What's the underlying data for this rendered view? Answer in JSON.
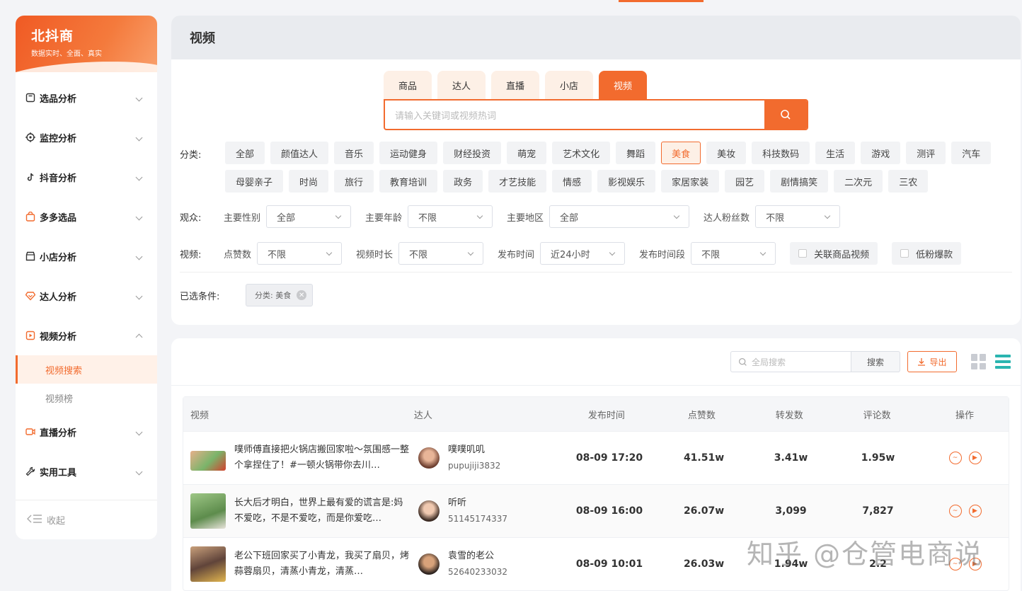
{
  "brand": {
    "name": "北抖商",
    "tagline": "数据实时、全面、真实"
  },
  "sidebar": {
    "items": [
      {
        "label": "选品分析",
        "icon": "box-icon"
      },
      {
        "label": "监控分析",
        "icon": "target-icon"
      },
      {
        "label": "抖音分析",
        "icon": "douyin-icon"
      },
      {
        "label": "多多选品",
        "icon": "bag-icon"
      },
      {
        "label": "小店分析",
        "icon": "shop-icon"
      },
      {
        "label": "达人分析",
        "icon": "diamond-icon"
      },
      {
        "label": "视频分析",
        "icon": "video-icon",
        "expanded": true
      }
    ],
    "sub_items": [
      {
        "label": "视频搜索",
        "active": true
      },
      {
        "label": "视频榜"
      }
    ],
    "items_after": [
      {
        "label": "直播分析",
        "icon": "camera-icon"
      },
      {
        "label": "实用工具",
        "icon": "tool-icon"
      }
    ],
    "collapse_label": "收起"
  },
  "page": {
    "title": "视频"
  },
  "search": {
    "tabs": [
      "商品",
      "达人",
      "直播",
      "小店",
      "视频"
    ],
    "active_tab": "视频",
    "placeholder": "请输入关键词或视频热词"
  },
  "filters": {
    "category_label": "分类:",
    "categories": [
      "全部",
      "颜值达人",
      "音乐",
      "运动健身",
      "财经投资",
      "萌宠",
      "艺术文化",
      "舞蹈",
      "美食",
      "美妆",
      "科技数码",
      "生活",
      "游戏",
      "测评",
      "汽车",
      "母婴亲子",
      "时尚",
      "旅行",
      "教育培训",
      "政务",
      "才艺技能",
      "情感",
      "影视娱乐",
      "家居家装",
      "园艺",
      "剧情搞笑",
      "二次元",
      "三农"
    ],
    "active_category": "美食",
    "audience_label": "观众:",
    "audience": [
      {
        "label": "主要性别",
        "value": "全部"
      },
      {
        "label": "主要年龄",
        "value": "不限"
      },
      {
        "label": "主要地区",
        "value": "全部"
      },
      {
        "label": "达人粉丝数",
        "value": "不限"
      }
    ],
    "video_label": "视频:",
    "video": [
      {
        "label": "点赞数",
        "value": "不限"
      },
      {
        "label": "视频时长",
        "value": "不限"
      },
      {
        "label": "发布时间",
        "value": "近24小时"
      },
      {
        "label": "发布时间段",
        "value": "不限"
      }
    ],
    "checks": [
      "关联商品视频",
      "低粉爆款"
    ],
    "selected_label": "已选条件:",
    "selected_tag": "分类: 美食"
  },
  "results": {
    "global_search_placeholder": "全局搜索",
    "search_button": "搜索",
    "export_button": "导出",
    "columns": [
      "视频",
      "达人",
      "发布时间",
      "点赞数",
      "转发数",
      "评论数",
      "操作"
    ],
    "rows": [
      {
        "title": "噗师傅直接把火锅店搬回家啦～氛围感一整个拿捏住了！#一顿火锅带你去川…",
        "talent": "噗噗叽叽",
        "talent_id": "pupujiji3832",
        "time": "08-09 17:20",
        "likes": "41.51w",
        "shares": "3.41w",
        "comments": "1.95w"
      },
      {
        "title": "长大后才明白，世界上最有爱的谎言是:妈不爱吃，不是不爱吃，而是你爱吃…",
        "talent": "听听",
        "talent_id": "51145174337",
        "time": "08-09 16:00",
        "likes": "26.07w",
        "shares": "3,099",
        "comments": "7,827"
      },
      {
        "title": "老公下班回家买了小青龙，我买了扇贝，烤蒜蓉扇贝，清蒸小青龙，清蒸…",
        "talent": "袁雪的老公",
        "talent_id": "52640233032",
        "time": "08-09 10:01",
        "likes": "26.03w",
        "shares": "1.94w",
        "comments": "2.2"
      }
    ]
  },
  "watermark": "知乎 @仓管电商说"
}
